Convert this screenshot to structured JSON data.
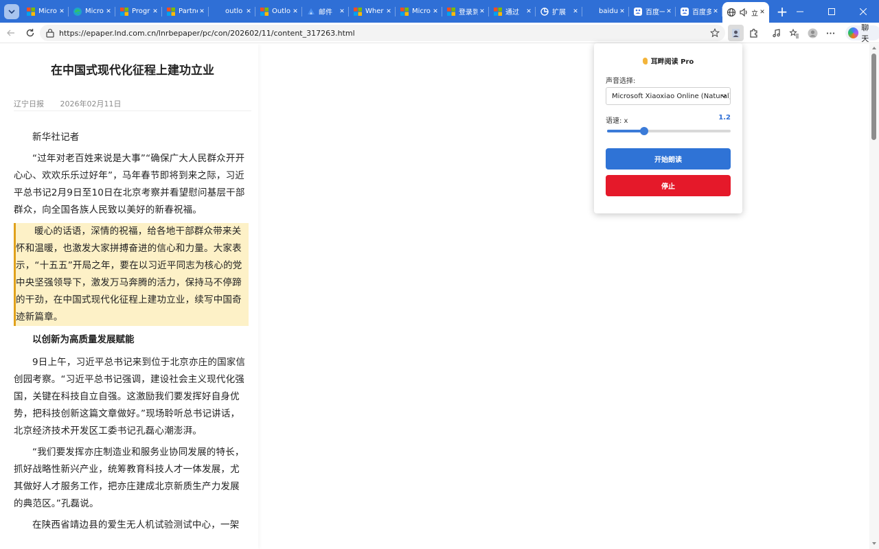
{
  "browser": {
    "tabs": [
      {
        "title": "Micro",
        "icon": "ms-logo-icon",
        "active": false
      },
      {
        "title": "Micro",
        "icon": "edge-icon",
        "active": false
      },
      {
        "title": "Progr",
        "icon": "ms-logo-icon",
        "active": false
      },
      {
        "title": "Partne",
        "icon": "ms-logo-icon",
        "active": false
      },
      {
        "title": "outlo",
        "icon": "blank-icon",
        "active": false
      },
      {
        "title": "Outlo",
        "icon": "ms-logo-icon",
        "active": false
      },
      {
        "title": "邮件",
        "icon": "mail-icon",
        "active": false
      },
      {
        "title": "Wher",
        "icon": "ms-logo-icon",
        "active": false
      },
      {
        "title": "Micro",
        "icon": "ms-logo-icon",
        "active": false
      },
      {
        "title": "登录到",
        "icon": "ms-logo-icon",
        "active": false
      },
      {
        "title": "通过",
        "icon": "ms-logo-icon",
        "active": false
      },
      {
        "title": "扩展",
        "icon": "extension-icon",
        "active": false
      },
      {
        "title": "baidu",
        "icon": "blank-icon",
        "active": false
      },
      {
        "title": "百度一",
        "icon": "baidu-icon",
        "active": false
      },
      {
        "title": "百度多",
        "icon": "baidu-icon",
        "active": false
      },
      {
        "title": "立",
        "icon": "globe-icon",
        "active": true
      }
    ],
    "new_tab": "+",
    "address": "https://epaper.lnd.com.cn/lnrbepaper/pc/con/202602/11/content_317263.html",
    "chat_label": "聊天",
    "colors": {
      "accent": "#2f6fd6",
      "tabstrip": "#2f6fd6"
    }
  },
  "article": {
    "title": "在中国式现代化征程上建功立业",
    "source": "辽宁日报",
    "date": "2026年02月11日",
    "paragraphs": [
      "新华社记者",
      "“过年对老百姓来说是大事”“确保广大人民群众开开心心、欢欢乐乐过好年”，马年春节即将到来之际，习近平总书记2月9日至10日在北京考察并看望慰问基层干部群众，向全国各族人民致以美好的新春祝福。",
      "暖心的话语，深情的祝福，给各地干部群众带来关怀和温暖，也激发大家拼搏奋进的信心和力量。大家表示，“十五五”开局之年，要在以习近平同志为核心的党中央坚强领导下，激发万马奔腾的活力，保持马不停蹄的干劲，在中国式现代化征程上建功立业，续写中国奇迹新篇章。",
      "以创新为高质量发展赋能",
      "9日上午，习近平总书记来到位于北京亦庄的国家信创园考察。“习近平总书记强调，建设社会主义现代化强国，关键在科技自立自强。这激励我们要发挥好自身优势，把科技创新这篇文章做好。”现场聆听总书记讲话，北京经济技术开发区工委书记孔磊心潮澎湃。",
      "“我们要发挥亦庄制造业和服务业协同发展的特长，抓好战略性新兴产业，统筹教育科技人才一体发展，尤其做好人才服务工作，把亦庄建成北京新质生产力发展的典范区。”孔磊说。",
      "在陕西省靖边县的爱生无人机试验测试中心，一架"
    ]
  },
  "popup": {
    "title": "耳畔阅读 Pro",
    "voice_label": "声音选择:",
    "voice_value": "Microsoft Xiaoxiao Online (Natural)",
    "rate_label": "语速: x",
    "rate_value": "1.2",
    "rate_fraction": 0.3,
    "start_label": "开始朗读",
    "stop_label": "停止",
    "colors": {
      "start": "#2f73d6",
      "stop": "#e5192a",
      "slider": "#3b7bd8"
    }
  }
}
